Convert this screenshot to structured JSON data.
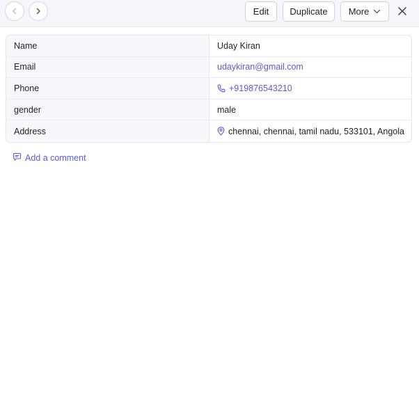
{
  "toolbar": {
    "prev_icon": "chevron-left-icon",
    "next_icon": "chevron-right-icon",
    "edit_label": "Edit",
    "duplicate_label": "Duplicate",
    "more_label": "More",
    "more_icon": "chevron-down-icon",
    "close_icon": "close-icon"
  },
  "details": {
    "rows": [
      {
        "label": "Name",
        "value": "Uday Kiran"
      },
      {
        "label": "Email",
        "value": "udaykiran@gmail.com"
      },
      {
        "label": "Phone",
        "value": "+919876543210",
        "icon": "phone-icon"
      },
      {
        "label": "gender",
        "value": "male"
      },
      {
        "label": "Address",
        "value": "chennai, chennai, tamil nadu, 533101, Angola",
        "icon": "location-pin-icon"
      }
    ]
  },
  "comment": {
    "label": "Add a comment",
    "icon": "comment-icon"
  },
  "colors": {
    "link": "#5b5bd6",
    "toolbar_bg": "#f5f6fb",
    "label_bg": "#f7f8fc"
  }
}
